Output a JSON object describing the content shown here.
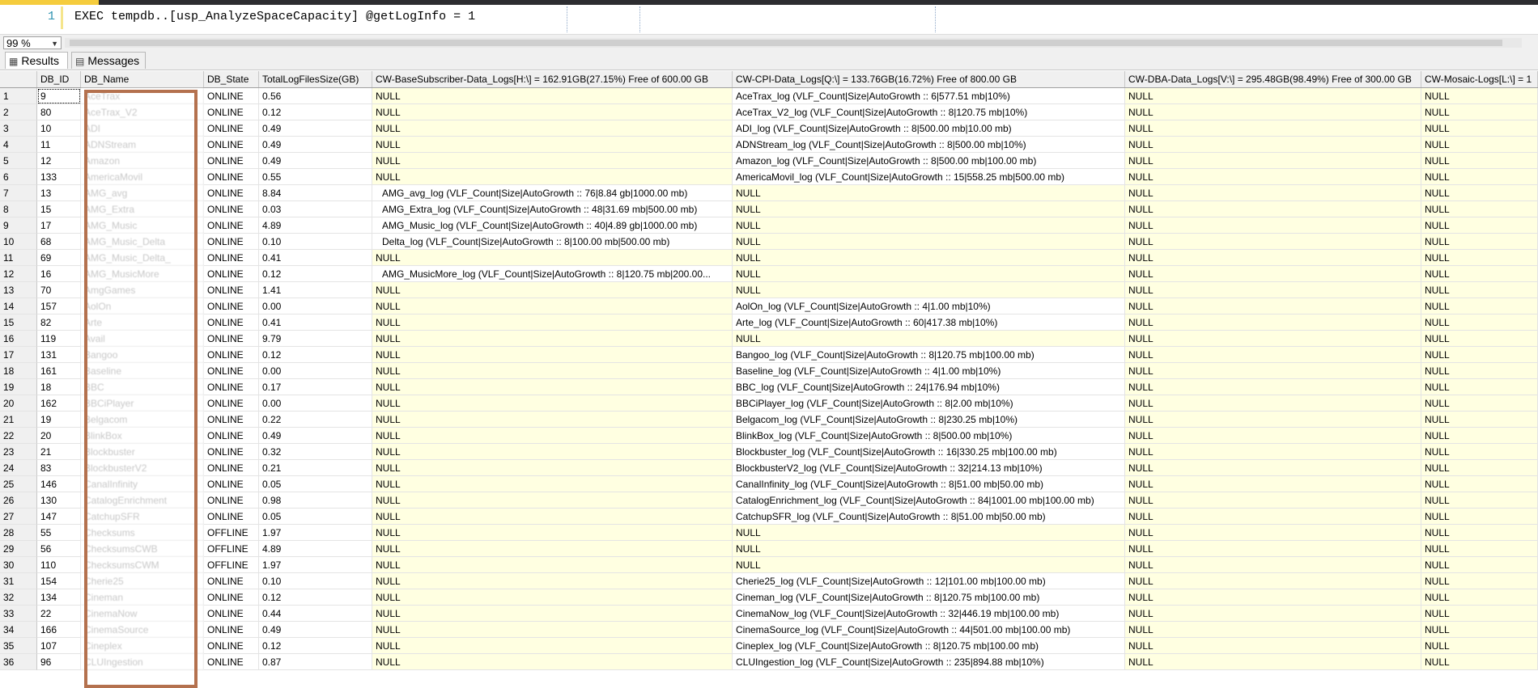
{
  "editor": {
    "line_number": "1",
    "code": "EXEC tempdb..[usp_AnalyzeSpaceCapacity] @getLogInfo = 1"
  },
  "toolbar": {
    "zoom": "99 %"
  },
  "tabs": {
    "results_label": "Results",
    "messages_label": "Messages"
  },
  "grid": {
    "columns": [
      "",
      "DB_ID",
      "DB_Name",
      "DB_State",
      "TotalLogFilesSize(GB)",
      "CW-BaseSubscriber-Data_Logs[H:\\] = 162.91GB(27.15%) Free of 600.00 GB",
      "CW-CPI-Data_Logs[Q:\\] = 133.76GB(16.72%) Free of 800.00 GB",
      "CW-DBA-Data_Logs[V:\\] = 295.48GB(98.49%) Free of 300.00 GB",
      "CW-Mosaic-Logs[L:\\] = 1"
    ],
    "rows": [
      {
        "n": "1",
        "id": "9",
        "name": "AceTrax",
        "state": "ONLINE",
        "size": "0.56",
        "h": "NULL",
        "q": "AceTrax_log (VLF_Count|Size|AutoGrowth :: 6|577.51 mb|10%)",
        "v": "NULL",
        "l": "NULL"
      },
      {
        "n": "2",
        "id": "80",
        "name": "AceTrax_V2",
        "state": "ONLINE",
        "size": "0.12",
        "h": "NULL",
        "q": "AceTrax_V2_log (VLF_Count|Size|AutoGrowth :: 8|120.75 mb|10%)",
        "v": "NULL",
        "l": "NULL"
      },
      {
        "n": "3",
        "id": "10",
        "name": "ADI",
        "state": "ONLINE",
        "size": "0.49",
        "h": "NULL",
        "q": "ADI_log (VLF_Count|Size|AutoGrowth :: 8|500.00 mb|10.00 mb)",
        "v": "NULL",
        "l": "NULL"
      },
      {
        "n": "4",
        "id": "11",
        "name": "ADNStream",
        "state": "ONLINE",
        "size": "0.49",
        "h": "NULL",
        "q": "ADNStream_log (VLF_Count|Size|AutoGrowth :: 8|500.00 mb|10%)",
        "v": "NULL",
        "l": "NULL"
      },
      {
        "n": "5",
        "id": "12",
        "name": "Amazon",
        "state": "ONLINE",
        "size": "0.49",
        "h": "NULL",
        "q": "Amazon_log (VLF_Count|Size|AutoGrowth :: 8|500.00 mb|100.00 mb)",
        "v": "NULL",
        "l": "NULL"
      },
      {
        "n": "6",
        "id": "133",
        "name": "AmericaMovil",
        "state": "ONLINE",
        "size": "0.55",
        "h": "NULL",
        "q": "AmericaMovil_log (VLF_Count|Size|AutoGrowth :: 15|558.25 mb|500.00 mb)",
        "v": "NULL",
        "l": "NULL"
      },
      {
        "n": "7",
        "id": "13",
        "name": "AMG_avg",
        "state": "ONLINE",
        "size": "8.84",
        "h": "AMG_avg_log (VLF_Count|Size|AutoGrowth :: 76|8.84 gb|1000.00 mb)",
        "q": "NULL",
        "v": "NULL",
        "l": "NULL"
      },
      {
        "n": "8",
        "id": "15",
        "name": "AMG_Extra",
        "state": "ONLINE",
        "size": "0.03",
        "h": "AMG_Extra_log (VLF_Count|Size|AutoGrowth :: 48|31.69 mb|500.00 mb)",
        "q": "NULL",
        "v": "NULL",
        "l": "NULL"
      },
      {
        "n": "9",
        "id": "17",
        "name": "AMG_Music",
        "state": "ONLINE",
        "size": "4.89",
        "h": "AMG_Music_log (VLF_Count|Size|AutoGrowth :: 40|4.89 gb|1000.00 mb)",
        "q": "NULL",
        "v": "NULL",
        "l": "NULL"
      },
      {
        "n": "10",
        "id": "68",
        "name": "AMG_Music_Delta",
        "state": "ONLINE",
        "size": "0.10",
        "h": "Delta_log (VLF_Count|Size|AutoGrowth :: 8|100.00 mb|500.00 mb)",
        "q": "NULL",
        "v": "NULL",
        "l": "NULL"
      },
      {
        "n": "11",
        "id": "69",
        "name": "AMG_Music_Delta_",
        "state": "ONLINE",
        "size": "0.41",
        "h": "NULL",
        "q": "NULL",
        "v": "NULL",
        "l": "NULL"
      },
      {
        "n": "12",
        "id": "16",
        "name": "AMG_MusicMore",
        "state": "ONLINE",
        "size": "0.12",
        "h": "AMG_MusicMore_log (VLF_Count|Size|AutoGrowth :: 8|120.75 mb|200.00...",
        "q": "NULL",
        "v": "NULL",
        "l": "NULL"
      },
      {
        "n": "13",
        "id": "70",
        "name": "AmgGames",
        "state": "ONLINE",
        "size": "1.41",
        "h": "NULL",
        "q": "NULL",
        "v": "NULL",
        "l": "NULL"
      },
      {
        "n": "14",
        "id": "157",
        "name": "AolOn",
        "state": "ONLINE",
        "size": "0.00",
        "h": "NULL",
        "q": "AolOn_log (VLF_Count|Size|AutoGrowth :: 4|1.00 mb|10%)",
        "v": "NULL",
        "l": "NULL"
      },
      {
        "n": "15",
        "id": "82",
        "name": "Arte",
        "state": "ONLINE",
        "size": "0.41",
        "h": "NULL",
        "q": "Arte_log (VLF_Count|Size|AutoGrowth :: 60|417.38 mb|10%)",
        "v": "NULL",
        "l": "NULL"
      },
      {
        "n": "16",
        "id": "119",
        "name": "Avail",
        "state": "ONLINE",
        "size": "9.79",
        "h": "NULL",
        "q": "NULL",
        "v": "NULL",
        "l": "NULL"
      },
      {
        "n": "17",
        "id": "131",
        "name": "Bangoo",
        "state": "ONLINE",
        "size": "0.12",
        "h": "NULL",
        "q": "Bangoo_log (VLF_Count|Size|AutoGrowth :: 8|120.75 mb|100.00 mb)",
        "v": "NULL",
        "l": "NULL"
      },
      {
        "n": "18",
        "id": "161",
        "name": "Baseline",
        "state": "ONLINE",
        "size": "0.00",
        "h": "NULL",
        "q": "Baseline_log (VLF_Count|Size|AutoGrowth :: 4|1.00 mb|10%)",
        "v": "NULL",
        "l": "NULL"
      },
      {
        "n": "19",
        "id": "18",
        "name": "BBC",
        "state": "ONLINE",
        "size": "0.17",
        "h": "NULL",
        "q": "BBC_log (VLF_Count|Size|AutoGrowth :: 24|176.94 mb|10%)",
        "v": "NULL",
        "l": "NULL"
      },
      {
        "n": "20",
        "id": "162",
        "name": "BBCiPlayer",
        "state": "ONLINE",
        "size": "0.00",
        "h": "NULL",
        "q": "BBCiPlayer_log (VLF_Count|Size|AutoGrowth :: 8|2.00 mb|10%)",
        "v": "NULL",
        "l": "NULL"
      },
      {
        "n": "21",
        "id": "19",
        "name": "Belgacom",
        "state": "ONLINE",
        "size": "0.22",
        "h": "NULL",
        "q": "Belgacom_log (VLF_Count|Size|AutoGrowth :: 8|230.25 mb|10%)",
        "v": "NULL",
        "l": "NULL"
      },
      {
        "n": "22",
        "id": "20",
        "name": "BlinkBox",
        "state": "ONLINE",
        "size": "0.49",
        "h": "NULL",
        "q": "BlinkBox_log (VLF_Count|Size|AutoGrowth :: 8|500.00 mb|10%)",
        "v": "NULL",
        "l": "NULL"
      },
      {
        "n": "23",
        "id": "21",
        "name": "Blockbuster",
        "state": "ONLINE",
        "size": "0.32",
        "h": "NULL",
        "q": "Blockbuster_log (VLF_Count|Size|AutoGrowth :: 16|330.25 mb|100.00 mb)",
        "v": "NULL",
        "l": "NULL"
      },
      {
        "n": "24",
        "id": "83",
        "name": "BlockbusterV2",
        "state": "ONLINE",
        "size": "0.21",
        "h": "NULL",
        "q": "BlockbusterV2_log (VLF_Count|Size|AutoGrowth :: 32|214.13 mb|10%)",
        "v": "NULL",
        "l": "NULL"
      },
      {
        "n": "25",
        "id": "146",
        "name": "CanalInfinity",
        "state": "ONLINE",
        "size": "0.05",
        "h": "NULL",
        "q": "CanalInfinity_log (VLF_Count|Size|AutoGrowth :: 8|51.00 mb|50.00 mb)",
        "v": "NULL",
        "l": "NULL"
      },
      {
        "n": "26",
        "id": "130",
        "name": "CatalogEnrichment",
        "state": "ONLINE",
        "size": "0.98",
        "h": "NULL",
        "q": "CatalogEnrichment_log (VLF_Count|Size|AutoGrowth :: 84|1001.00 mb|100.00 mb)",
        "v": "NULL",
        "l": "NULL"
      },
      {
        "n": "27",
        "id": "147",
        "name": "CatchupSFR",
        "state": "ONLINE",
        "size": "0.05",
        "h": "NULL",
        "q": "CatchupSFR_log (VLF_Count|Size|AutoGrowth :: 8|51.00 mb|50.00 mb)",
        "v": "NULL",
        "l": "NULL"
      },
      {
        "n": "28",
        "id": "55",
        "name": "Checksums",
        "state": "OFFLINE",
        "size": "1.97",
        "h": "NULL",
        "q": "NULL",
        "v": "NULL",
        "l": "NULL"
      },
      {
        "n": "29",
        "id": "56",
        "name": "ChecksumsCWB",
        "state": "OFFLINE",
        "size": "4.89",
        "h": "NULL",
        "q": "NULL",
        "v": "NULL",
        "l": "NULL"
      },
      {
        "n": "30",
        "id": "110",
        "name": "ChecksumsCWM",
        "state": "OFFLINE",
        "size": "1.97",
        "h": "NULL",
        "q": "NULL",
        "v": "NULL",
        "l": "NULL"
      },
      {
        "n": "31",
        "id": "154",
        "name": "Cherie25",
        "state": "ONLINE",
        "size": "0.10",
        "h": "NULL",
        "q": "Cherie25_log (VLF_Count|Size|AutoGrowth :: 12|101.00 mb|100.00 mb)",
        "v": "NULL",
        "l": "NULL"
      },
      {
        "n": "32",
        "id": "134",
        "name": "Cineman",
        "state": "ONLINE",
        "size": "0.12",
        "h": "NULL",
        "q": "Cineman_log (VLF_Count|Size|AutoGrowth :: 8|120.75 mb|100.00 mb)",
        "v": "NULL",
        "l": "NULL"
      },
      {
        "n": "33",
        "id": "22",
        "name": "CinemaNow",
        "state": "ONLINE",
        "size": "0.44",
        "h": "NULL",
        "q": "CinemaNow_log (VLF_Count|Size|AutoGrowth :: 32|446.19 mb|100.00 mb)",
        "v": "NULL",
        "l": "NULL"
      },
      {
        "n": "34",
        "id": "166",
        "name": "CinemaSource",
        "state": "ONLINE",
        "size": "0.49",
        "h": "NULL",
        "q": "CinemaSource_log (VLF_Count|Size|AutoGrowth :: 44|501.00 mb|100.00 mb)",
        "v": "NULL",
        "l": "NULL"
      },
      {
        "n": "35",
        "id": "107",
        "name": "Cineplex",
        "state": "ONLINE",
        "size": "0.12",
        "h": "NULL",
        "q": "Cineplex_log (VLF_Count|Size|AutoGrowth :: 8|120.75 mb|100.00 mb)",
        "v": "NULL",
        "l": "NULL"
      },
      {
        "n": "36",
        "id": "96",
        "name": "CLUIngestion",
        "state": "ONLINE",
        "size": "0.87",
        "h": "NULL",
        "q": "CLUIngestion_log (VLF_Count|Size|AutoGrowth :: 235|894.88 mb|10%)",
        "v": "NULL",
        "l": "NULL"
      }
    ]
  }
}
